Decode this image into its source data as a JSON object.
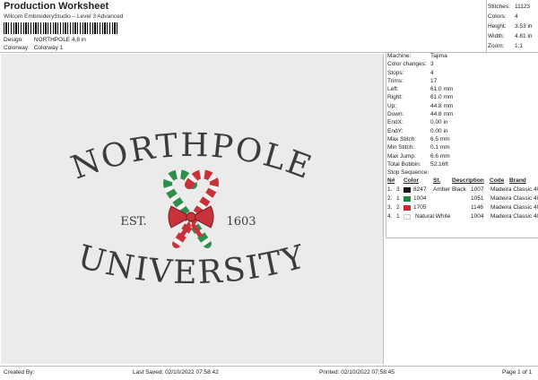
{
  "header": {
    "title": "Production Worksheet",
    "subtitle": "Wilcom EmbroideryStudio – Level 3 Advanced",
    "design_label": "Design:",
    "design_value": "NORTHPOLE 4,8 in",
    "colorway_label": "Colorway:",
    "colorway_value": "Colorway 1"
  },
  "stats": [
    {
      "label": "Stitches:",
      "value": "11123"
    },
    {
      "label": "Colors:",
      "value": "4"
    },
    {
      "label": "Height:",
      "value": "3.53 in"
    },
    {
      "label": "Width:",
      "value": "4.81 in"
    },
    {
      "label": "Zoom:",
      "value": "1:1"
    }
  ],
  "design": {
    "line1": "NORTHPOLE",
    "est": "EST.",
    "year": "1603",
    "line2": "UNIVERSITY",
    "colors": {
      "thread": "#3c3c3a",
      "cane_red": "#c8333a",
      "cane_green": "#2e8f4c",
      "cane_white": "#f4f4f4",
      "background": "#ebebeb"
    }
  },
  "info": [
    {
      "label": "Machine:",
      "value": "Tajima"
    },
    {
      "label": "Color changes:",
      "value": "3"
    },
    {
      "label": "Stops:",
      "value": "4"
    },
    {
      "label": "Trims:",
      "value": "17"
    },
    {
      "label": "Left:",
      "value": "61.0 mm"
    },
    {
      "label": "Right:",
      "value": "61.0 mm"
    },
    {
      "label": "Up:",
      "value": "44.8 mm"
    },
    {
      "label": "Down:",
      "value": "44.8 mm"
    },
    {
      "label": "EndX:",
      "value": "0.00 in"
    },
    {
      "label": "EndY:",
      "value": "0.00 in"
    },
    {
      "label": "Max Stitch:",
      "value": "6.5 mm"
    },
    {
      "label": "Min Stitch:",
      "value": "0.1 mm"
    },
    {
      "label": "Max Jump:",
      "value": "6.6 mm"
    },
    {
      "label": "Total Bobbin:",
      "value": "52.16ft"
    }
  ],
  "sequence": {
    "title": "Stop Sequence:",
    "headers": {
      "n": "N#",
      "color": "Color",
      "st": "St.",
      "desc": "Description",
      "code": "Code",
      "brand": "Brand"
    },
    "rows": [
      {
        "num": "1.",
        "stop": "3",
        "swatch": "#1a1a1a",
        "color": "8247",
        "st": "",
        "desc": "Amber Black",
        "code": "1007",
        "brand": "Madeira Classic 40"
      },
      {
        "num": "2.",
        "stop": "1",
        "swatch": "#1f8a3f",
        "color": "1004",
        "st": "",
        "desc": "",
        "code": "1051",
        "brand": "Madeira Classic 40"
      },
      {
        "num": "3.",
        "stop": "2",
        "swatch": "#d0262d",
        "color": "1705",
        "st": "",
        "desc": "",
        "code": "1146",
        "brand": "Madeira Classic 40"
      },
      {
        "num": "4.",
        "stop": "1",
        "swatch": "#f4f4f4",
        "color": "",
        "st": "165",
        "desc": "Natural White",
        "code": "1004",
        "brand": "Madeira Classic 40"
      }
    ]
  },
  "footer": {
    "created_by": "Created By:",
    "last_saved": "Last Saved: 02/10/2022 07:58:42",
    "printed": "Printed: 02/10/2022 07:58:45",
    "page": "Page 1 of 1"
  }
}
